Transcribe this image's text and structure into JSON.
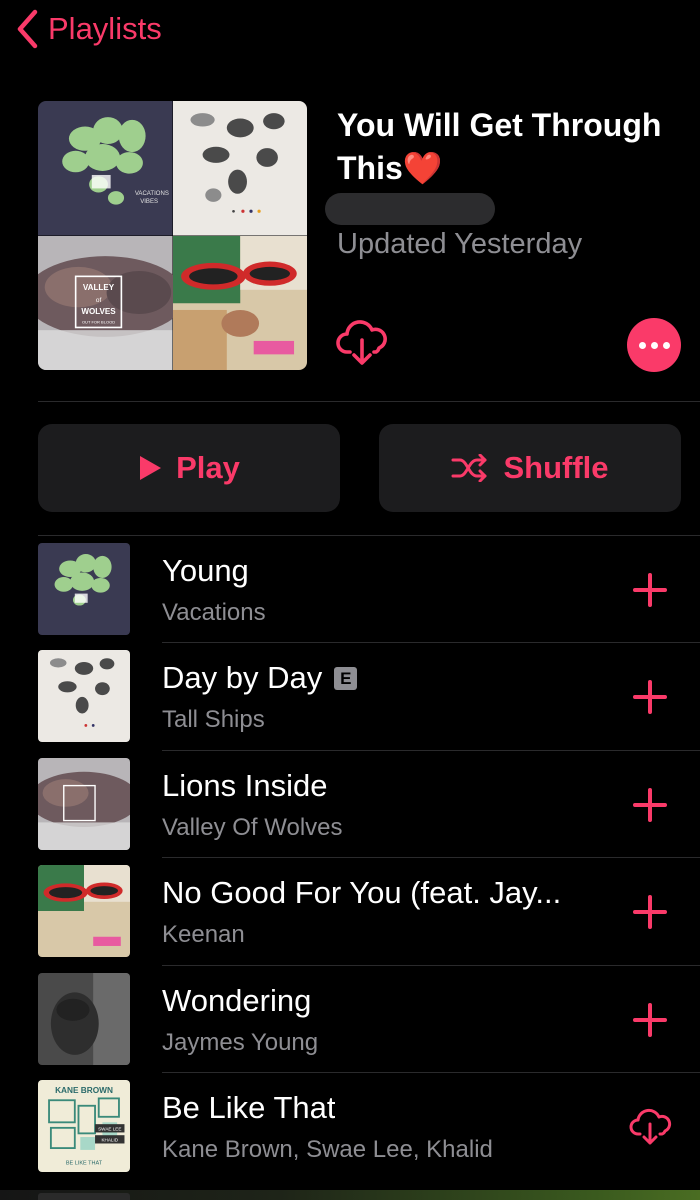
{
  "nav": {
    "back_label": "Playlists"
  },
  "playlist": {
    "title": "You Will Get Through This",
    "title_emoji": "❤️",
    "updated": "Updated Yesterday"
  },
  "buttons": {
    "play_label": "Play",
    "shuffle_label": "Shuffle"
  },
  "tracks": [
    {
      "title": "Young",
      "artist": "Vacations",
      "explicit": false,
      "action": "add"
    },
    {
      "title": "Day by Day",
      "artist": "Tall Ships",
      "explicit": true,
      "explicit_label": "E",
      "action": "add"
    },
    {
      "title": "Lions Inside",
      "artist": "Valley Of Wolves",
      "explicit": false,
      "action": "add"
    },
    {
      "title": "No Good For You (feat. Jay...",
      "artist": "Keenan",
      "explicit": false,
      "action": "add"
    },
    {
      "title": "Wondering",
      "artist": "Jaymes Young",
      "explicit": false,
      "action": "add"
    },
    {
      "title": "Be Like That",
      "artist": "Kane Brown, Swae Lee, Khalid",
      "explicit": false,
      "action": "download"
    }
  ],
  "artwork_text": {
    "vacations": [
      "VACATIONS",
      "VIBES"
    ],
    "valley": [
      "VALLEY",
      "of",
      "WOLVES",
      "OUT FOR BLOOD"
    ],
    "kane": [
      "KANE BROWN",
      "SWAE LEE",
      "KHALID",
      "BE LIKE THAT"
    ]
  },
  "colors": {
    "accent": "#fa3a69",
    "background": "#000000",
    "button_bg": "#1c1c1e",
    "secondary_text": "#8e8e93",
    "separator": "#2a2a2c"
  },
  "icons": {
    "back": "chevron-left-icon",
    "download": "cloud-download-icon",
    "more": "ellipsis-icon",
    "play": "play-icon",
    "shuffle": "shuffle-icon",
    "add": "plus-icon"
  }
}
